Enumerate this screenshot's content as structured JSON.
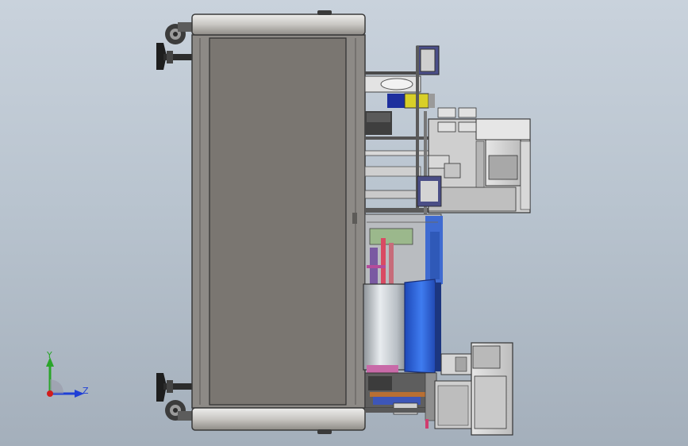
{
  "triad": {
    "y_label": "Y",
    "z_label": "Z",
    "colors": {
      "y": "#2aa52a",
      "z": "#1f3fd6",
      "x": "#d21c1c"
    }
  },
  "palette": {
    "cabinet_panel": "#7a7671",
    "cabinet_frame": "#8d8a86",
    "rail": "#d5d3cf",
    "drum_blue": "#2d62d8",
    "drum_steel": "#b9bec3",
    "yellow_part": "#d8cf28",
    "gray_box": "#d2d2d2"
  }
}
